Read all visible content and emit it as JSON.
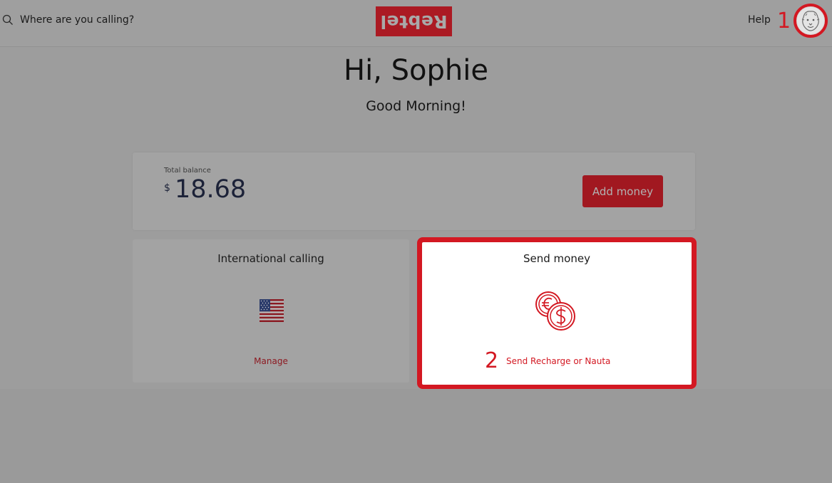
{
  "header": {
    "search_placeholder": "Where are you calling?",
    "logo_text": "Rebtel",
    "help_label": "Help",
    "marker_1": "1"
  },
  "main": {
    "greeting": "Hi, Sophie",
    "sub_greeting": "Good Morning!"
  },
  "balance": {
    "label": "Total balance",
    "currency": "$",
    "amount": "18.68",
    "add_money_label": "Add money"
  },
  "international_calling": {
    "title": "International calling",
    "flag_icon": "us-flag-icon",
    "manage_label": "Manage"
  },
  "send_money": {
    "title": "Send money",
    "icon": "euro-dollar-coins-icon",
    "link_label": "Send Recharge or Nauta",
    "marker_2": "2"
  },
  "colors": {
    "brand_red": "#d31822",
    "overlay_gray": "#9d9d9d"
  }
}
